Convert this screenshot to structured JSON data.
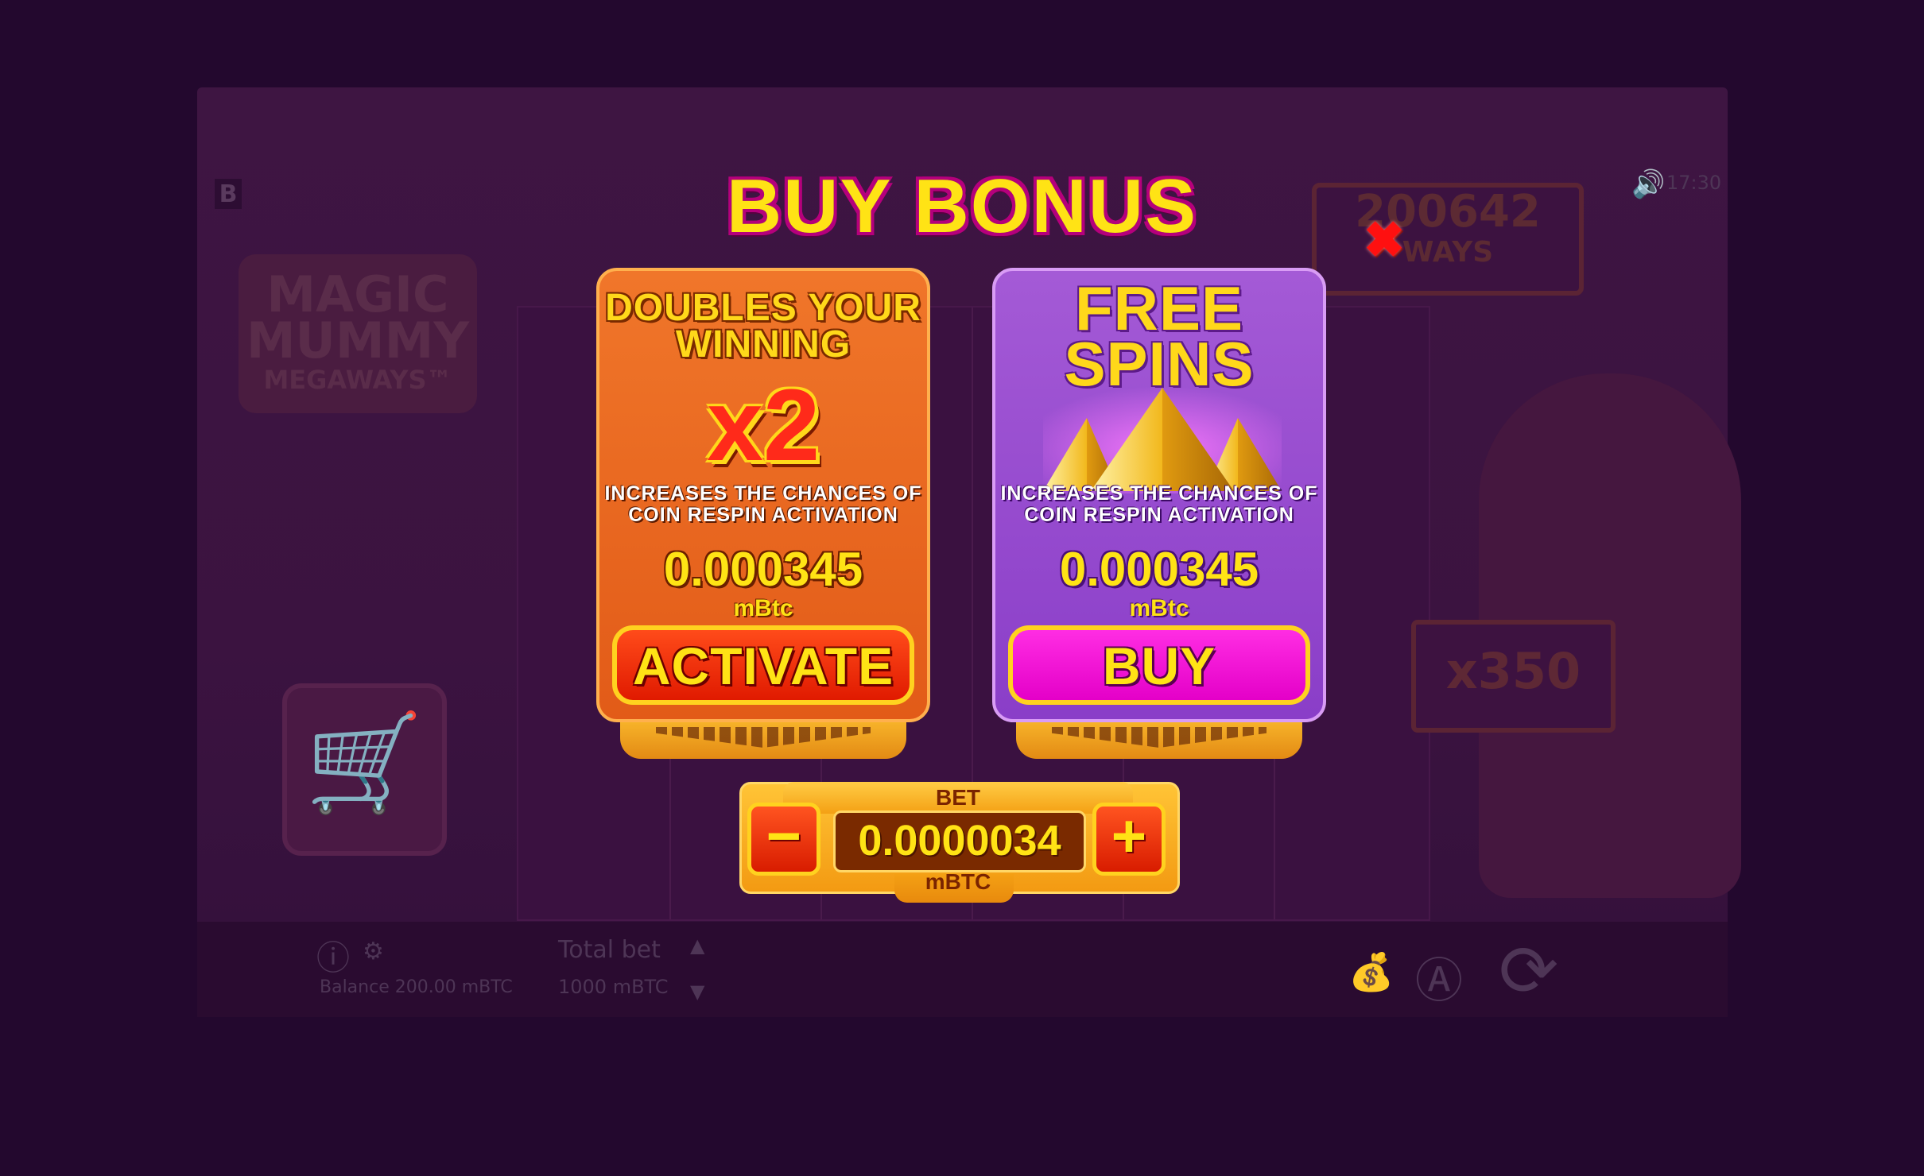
{
  "background": {
    "logo_badge": "B",
    "logo_line1": "MAGIC",
    "logo_line2": "MUMMY",
    "logo_line3": "MEGAWAYS™",
    "ways_value": "200642",
    "ways_label": "WAYS",
    "multiplier": "x350",
    "time": "17:30",
    "balance_text": "Balance 200.00 mBTC",
    "total_bet_label": "Total bet",
    "total_bet_value": "1000 mBTC"
  },
  "modal": {
    "title": "BUY BONUS",
    "close_icon": "close-icon",
    "cards": [
      {
        "headline": "DOUBLES YOUR WINNING",
        "feature": "x2",
        "description": "INCREASES THE CHANCES OF COIN RESPIN ACTIVATION",
        "price": "0.000345",
        "unit": "mBtc",
        "button": "ACTIVATE",
        "color": "#e8641f"
      },
      {
        "headline": "FREE SPINS",
        "feature_icon": "pyramids-icon",
        "description": "INCREASES THE CHANCES OF COIN RESPIN ACTIVATION",
        "price": "0.000345",
        "unit": "mBtc",
        "button": "BUY",
        "color": "#9a4ccf"
      }
    ],
    "bet": {
      "label": "BET",
      "value": "0.0000034",
      "unit": "mBTC",
      "minus_label": "−",
      "plus_label": "+"
    }
  }
}
